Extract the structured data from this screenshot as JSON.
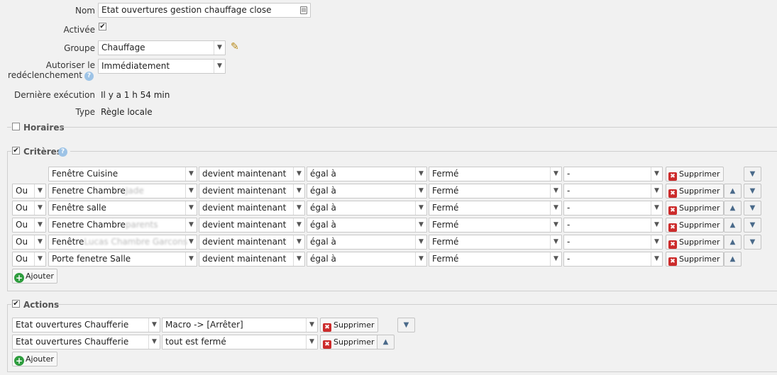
{
  "form": {
    "nom_label": "Nom",
    "nom_value": "Etat ouvertures gestion chauffage close",
    "activee_label": "Activée",
    "groupe_label": "Groupe",
    "groupe_value": "Chauffage",
    "autoriser_label_1": "Autoriser le",
    "autoriser_label_2": "redéclenchement",
    "autoriser_value": "Immédiatement",
    "derniere_label": "Dernière exécution",
    "derniere_value": "Il y a 1 h 54 min",
    "type_label": "Type",
    "type_value": "Règle locale"
  },
  "horaires": {
    "title": "Horaires"
  },
  "criteres": {
    "title": "Critères",
    "rows": [
      {
        "op": "",
        "device": "Fenêtre Cuisine",
        "device_blur": "",
        "event": "devient maintenant",
        "cmp": "égal à",
        "value": "Fermé",
        "extra": "-"
      },
      {
        "op": "Ou",
        "device": "Fenetre Chambre",
        "device_blur": "Jade",
        "event": "devient maintenant",
        "cmp": "égal à",
        "value": "Fermé",
        "extra": "-"
      },
      {
        "op": "Ou",
        "device": "Fenêtre salle",
        "device_blur": "",
        "event": "devient maintenant",
        "cmp": "égal à",
        "value": "Fermé",
        "extra": "-"
      },
      {
        "op": "Ou",
        "device": "Fenetre Chambre",
        "device_blur": "parents",
        "event": "devient maintenant",
        "cmp": "égal à",
        "value": "Fermé",
        "extra": "-"
      },
      {
        "op": "Ou",
        "device": "Fenêtre",
        "device_blur": "Lucas Chambre Garcons",
        "event": "devient maintenant",
        "cmp": "égal à",
        "value": "Fermé",
        "extra": "-"
      },
      {
        "op": "Ou",
        "device": "Porte fenetre Salle",
        "device_blur": "",
        "event": "devient maintenant",
        "cmp": "égal à",
        "value": "Fermé",
        "extra": "-"
      }
    ],
    "delete_label": "Supprimer",
    "add_label": "Ajouter"
  },
  "actions": {
    "title": "Actions",
    "rows": [
      {
        "target": "Etat ouvertures Chaufferie",
        "action": "Macro -> [Arrêter]"
      },
      {
        "target": "Etat ouvertures Chaufferie",
        "action": "tout est fermé"
      }
    ],
    "delete_label": "Supprimer",
    "add_label": "Ajouter"
  },
  "icons": {
    "arrow_up": "▲",
    "arrow_down": "▼",
    "dropdown": "▼",
    "check": "✔",
    "pencil": "✎",
    "help": "?",
    "delete_x": "✖",
    "add_plus": "+"
  },
  "colors": {
    "delete_red": "#cc2b2b",
    "add_green": "#2e9d3e",
    "help_blue": "#9dc3e6"
  }
}
